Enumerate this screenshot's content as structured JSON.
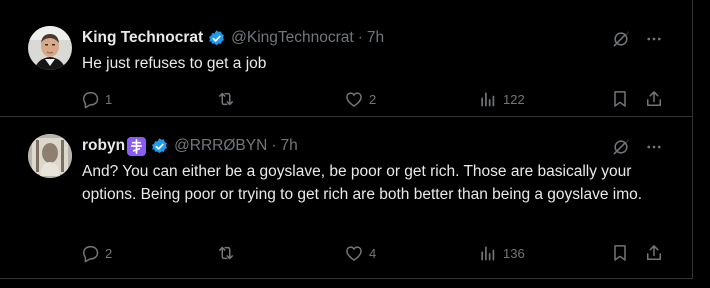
{
  "tweets": [
    {
      "name": "King Technocrat",
      "handle": "@KingTechnocrat",
      "dot": "·",
      "time": "7h",
      "text": "He just refuses to get a job",
      "replies": "1",
      "retweets": "",
      "likes": "2",
      "views": "122",
      "verified_color": "#1d9bf0"
    },
    {
      "name": "robyn",
      "name_emoji": "☦️",
      "handle": "@RRRØBYN",
      "dot": "·",
      "time": "7h",
      "text": "And? You can either be a goyslave, be poor or get rich. Those are basically your options. Being poor or trying to get rich are both better than being a goyslave imo.",
      "replies": "2",
      "retweets": "",
      "likes": "4",
      "views": "136",
      "verified_color": "#1d9bf0"
    }
  ],
  "colors": {
    "background": "#000000",
    "text_primary": "#e7e9ea",
    "text_secondary": "#71767b",
    "border": "#2f3336",
    "accent": "#1d9bf0"
  },
  "icons": [
    "reply-icon",
    "retweet-icon",
    "like-icon",
    "views-icon",
    "bookmark-icon",
    "share-icon",
    "grok-icon",
    "more-icon",
    "verified-badge-icon",
    "orthodox-cross-emoji"
  ]
}
